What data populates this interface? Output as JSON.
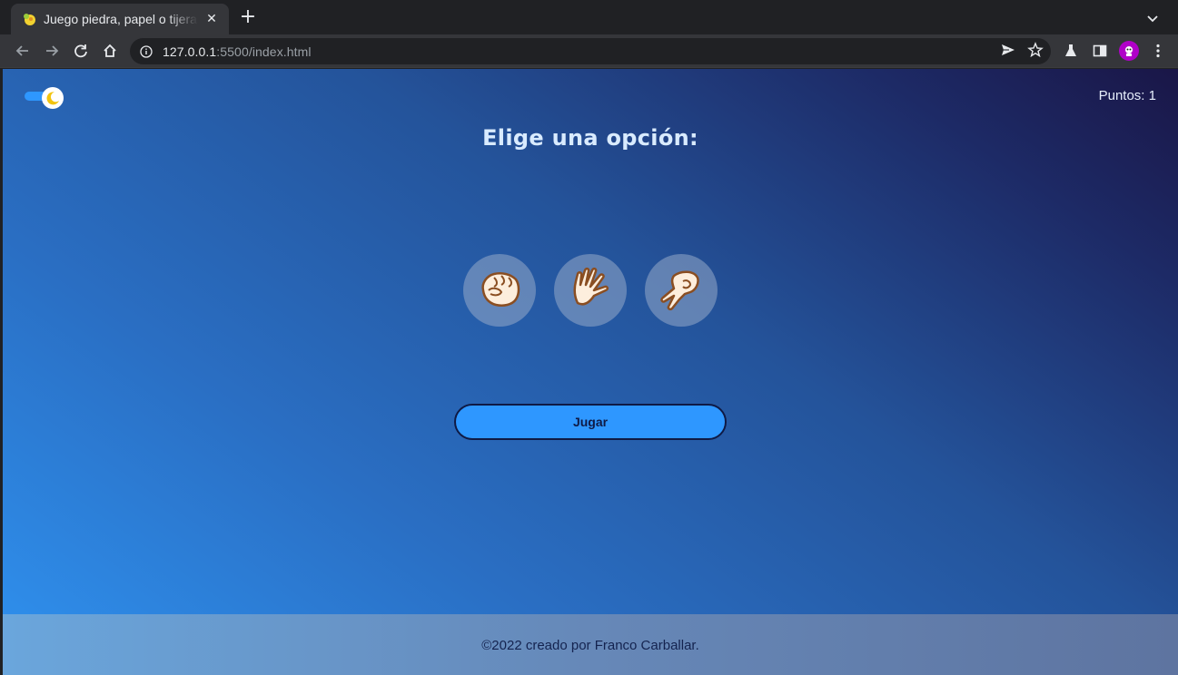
{
  "browser": {
    "tab_title": "Juego piedra, papel o tijeras",
    "url_host": "127.0.0.1",
    "url_rest": ":5500/index.html",
    "icons": [
      "back-icon",
      "forward-icon",
      "reload-icon",
      "home-icon",
      "info-icon",
      "send-icon",
      "star-icon",
      "labs-icon",
      "sidepanel-icon",
      "menu-icon"
    ]
  },
  "page": {
    "score_label": "Puntos: 1",
    "heading": "Elige una opción:",
    "options": [
      {
        "name": "piedra",
        "icon": "rock-fist-icon"
      },
      {
        "name": "papel",
        "icon": "paper-hand-icon"
      },
      {
        "name": "tijeras",
        "icon": "scissors-hand-icon"
      }
    ],
    "play_button": "Jugar",
    "footer_text": "©2022 creado por Franco Carballar.",
    "theme_toggle_icon": "moon-icon"
  },
  "colors": {
    "accent": "#2e97ff",
    "heading": "#d9ebff",
    "footer_text": "#14234f"
  }
}
